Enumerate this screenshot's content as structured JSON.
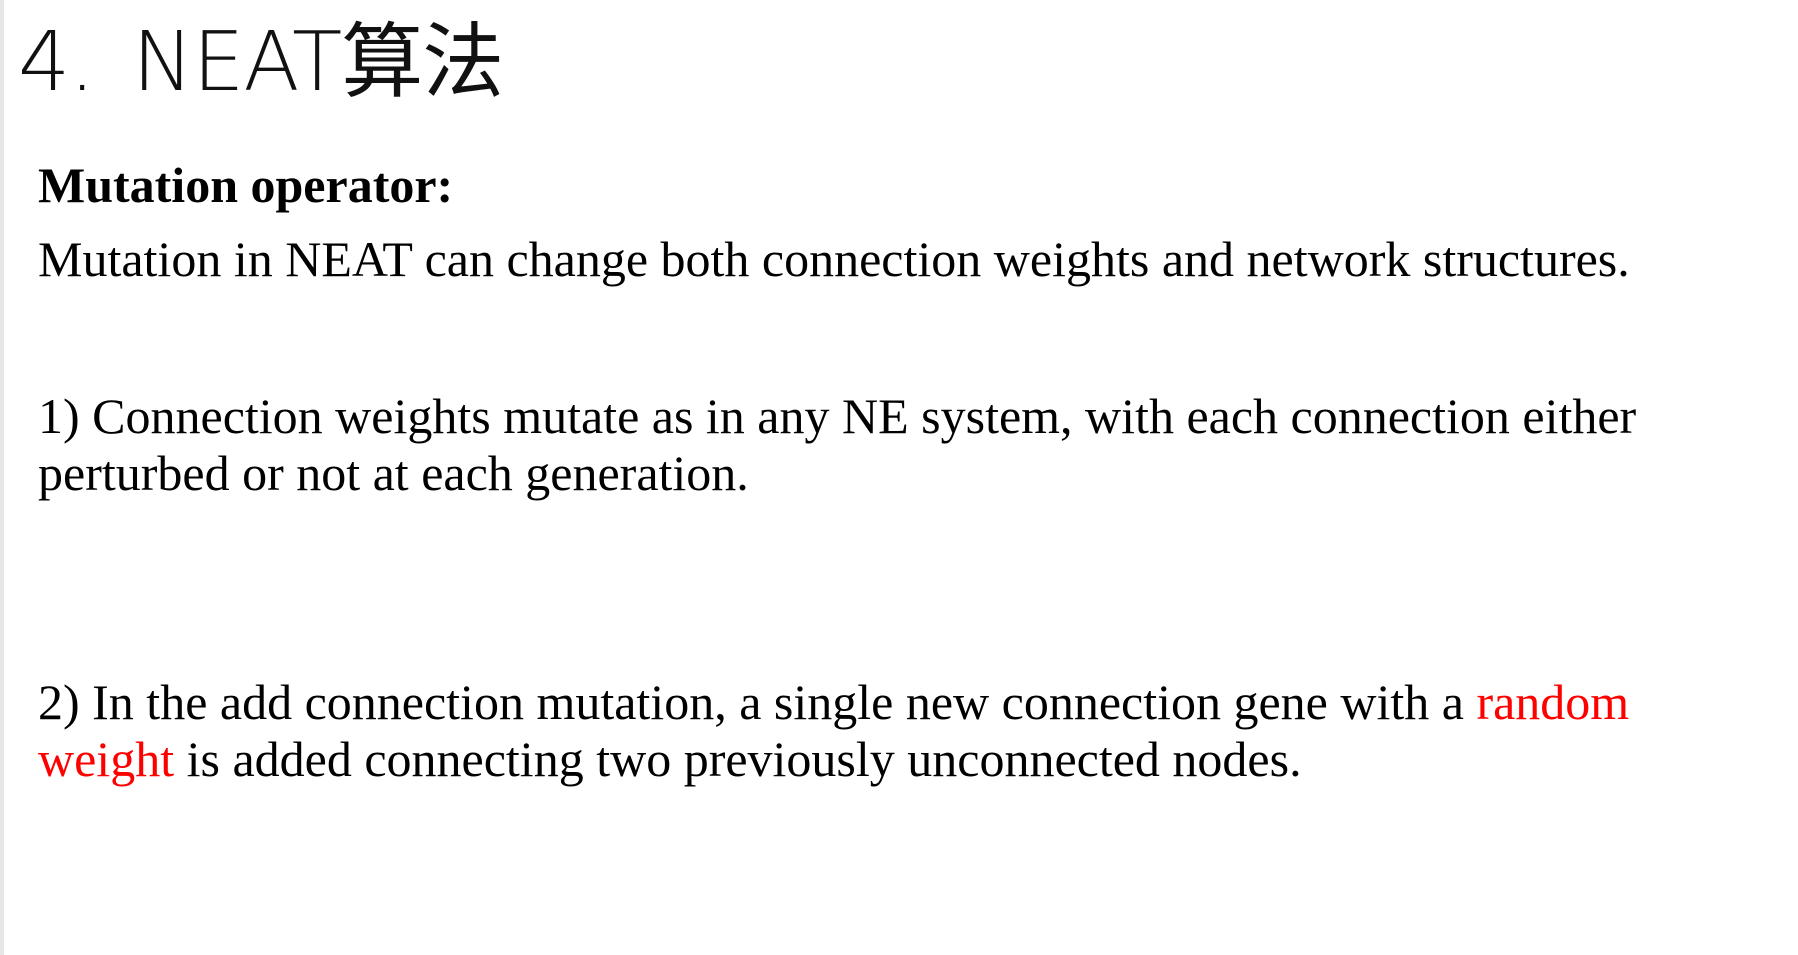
{
  "slide": {
    "title_number": "4.",
    "title_text": "NEAT算法",
    "heading": "Mutation operator:",
    "intro": "Mutation in NEAT can change both connection weights and network structures.",
    "point1": {
      "text": "1) Connection weights mutate as in any NE system, with each connection either perturbed or not at each generation."
    },
    "point2": {
      "text_before": "2) In the add connection mutation, a single new connection gene with a ",
      "highlight": "random weight",
      "text_after": " is added connecting two previously unconnected nodes."
    },
    "colors": {
      "text": "#000000",
      "highlight": "#ff0000",
      "background": "#ffffff"
    }
  }
}
